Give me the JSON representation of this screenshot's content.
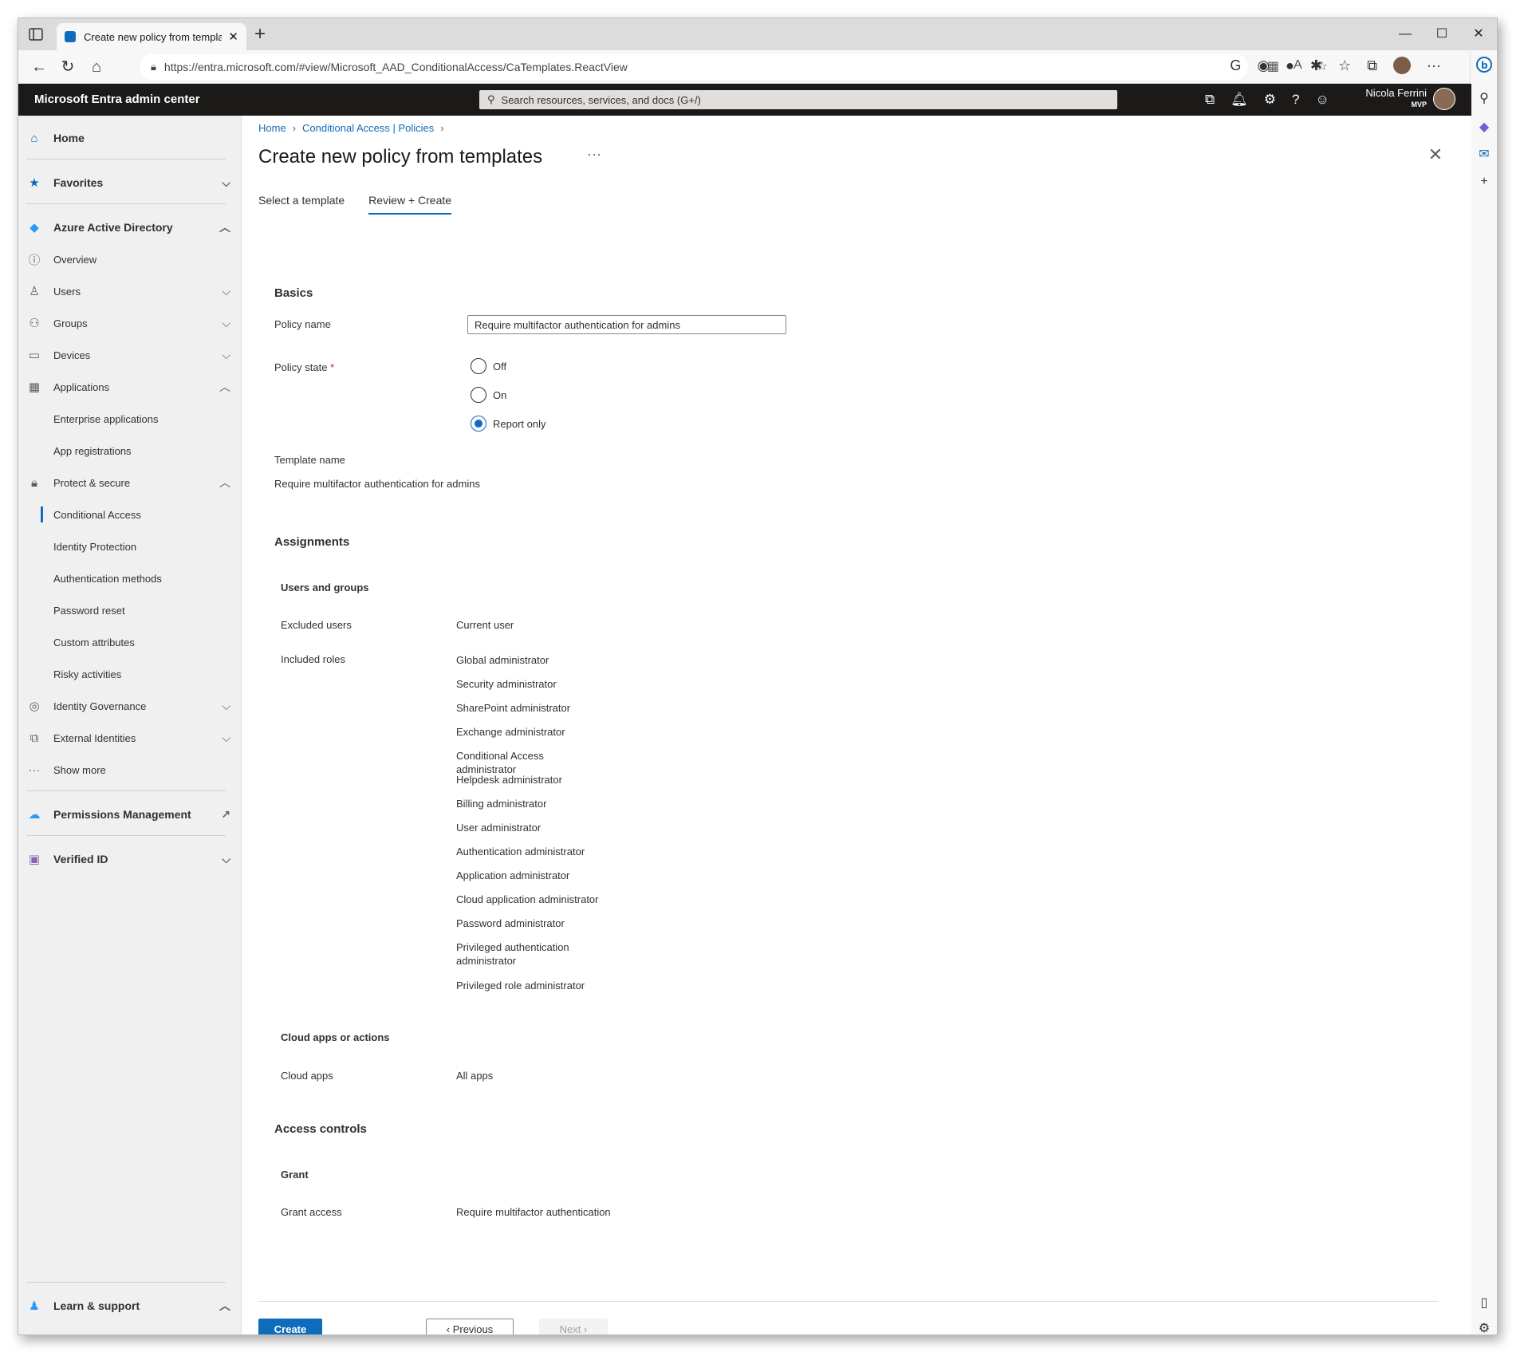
{
  "browser": {
    "tab_title": "Create new policy from template",
    "url": "https://entra.microsoft.com/#view/Microsoft_AAD_ConditionalAccess/CaTemplates.ReactView"
  },
  "header": {
    "app_title": "Microsoft Entra admin center",
    "search_placeholder": "Search resources, services, and docs (G+/)",
    "user_name": "Nicola Ferrini",
    "user_badge": "MVP"
  },
  "leftnav": {
    "home": "Home",
    "favorites": "Favorites",
    "aad": "Azure Active Directory",
    "overview": "Overview",
    "users": "Users",
    "groups": "Groups",
    "devices": "Devices",
    "applications": "Applications",
    "enterprise_apps": "Enterprise applications",
    "app_registrations": "App registrations",
    "protect_secure": "Protect & secure",
    "conditional_access": "Conditional Access",
    "identity_protection": "Identity Protection",
    "auth_methods": "Authentication methods",
    "password_reset": "Password reset",
    "custom_attributes": "Custom attributes",
    "risky_activities": "Risky activities",
    "identity_governance": "Identity Governance",
    "external_identities": "External Identities",
    "show_more": "Show more",
    "permissions_mgmt": "Permissions Management",
    "verified_id": "Verified ID",
    "learn_support": "Learn & support"
  },
  "breadcrumb": {
    "home": "Home",
    "ca_policies": "Conditional Access | Policies"
  },
  "page": {
    "title": "Create new policy from templates",
    "tab_select": "Select a template",
    "tab_review": "Review + Create"
  },
  "basics": {
    "title": "Basics",
    "policy_name_label": "Policy name",
    "policy_name_value": "Require multifactor authentication for admins",
    "policy_state_label": "Policy state",
    "required_mark": "*",
    "state_off": "Off",
    "state_on": "On",
    "state_report": "Report only",
    "template_name_label": "Template name",
    "template_name_value": "Require multifactor authentication for admins"
  },
  "assignments": {
    "title": "Assignments",
    "users_groups_title": "Users and groups",
    "excluded_users_label": "Excluded users",
    "excluded_users_value": "Current user",
    "included_roles_label": "Included roles",
    "roles": [
      "Global administrator",
      "Security administrator",
      "SharePoint administrator",
      "Exchange administrator",
      "Conditional Access administrator",
      "Helpdesk administrator",
      "Billing administrator",
      "User administrator",
      "Authentication administrator",
      "Application administrator",
      "Cloud application administrator",
      "Password administrator",
      "Privileged authentication administrator",
      "Privileged role administrator"
    ],
    "cloud_apps_title": "Cloud apps or actions",
    "cloud_apps_label": "Cloud apps",
    "cloud_apps_value": "All apps"
  },
  "access_controls": {
    "title": "Access controls",
    "grant_title": "Grant",
    "grant_access_label": "Grant access",
    "grant_access_value": "Require multifactor authentication"
  },
  "footer": {
    "create": "Create",
    "previous": "Previous",
    "next": "Next"
  },
  "colors": {
    "accent": "#0f6cbd",
    "header_bg": "#1b1a19",
    "nav_bg": "#f0f0f0"
  }
}
